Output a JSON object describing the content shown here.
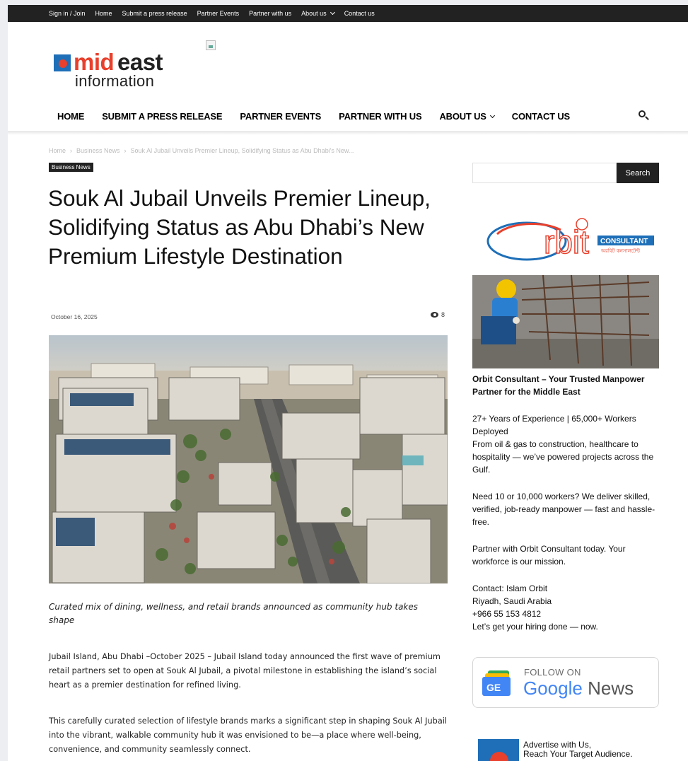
{
  "topbar": {
    "links": [
      "Sign in / Join",
      "Home",
      "Submit a press release",
      "Partner Events",
      "Partner with us",
      "About us",
      "Contact us"
    ]
  },
  "logo": {
    "part1": "mid",
    "part2": "east",
    "part3": "information"
  },
  "nav": {
    "items": [
      "HOME",
      "SUBMIT A PRESS RELEASE",
      "PARTNER EVENTS",
      "PARTNER WITH US",
      "ABOUT US",
      "CONTACT US"
    ],
    "search_icon": "search-icon"
  },
  "breadcrumb": {
    "items": [
      "Home",
      "Business News",
      "Souk Al Jubail Unveils Premier Lineup, Solidifying Status as Abu Dhabi's New..."
    ],
    "separator": "›"
  },
  "article": {
    "category": "Business News",
    "title": "Souk Al Jubail Unveils Premier Lineup, Solidifying Status as Abu Dhabi’s New Premium Lifestyle Destination",
    "date": "October 16, 2025",
    "views": "8",
    "caption": "Curated mix of dining, wellness, and retail brands announced as community hub takes shape",
    "paragraphs": [
      "Jubail Island, Abu Dhabi –October 2025 – Jubail Island today announced the first wave of premium retail partners set to open at Souk Al Jubail, a pivotal milestone in establishing the island’s social heart as a premier destination for refined living.",
      "This carefully curated selection of lifestyle brands marks a significant step in shaping Souk Al Jubail into the vibrant, walkable community hub it was envisioned to be—a place where well-being, convenience, and community seamlessly connect."
    ]
  },
  "sidebar": {
    "search_button": "Search",
    "orbit": {
      "logo_mark": "rbit",
      "logo_badge": "CONSULTANT",
      "logo_sub": "অরবিট কনসালটেন্ট"
    },
    "ad_headline": "Orbit Consultant – Your Trusted Manpower Partner for the Middle East",
    "ad_p1": "27+ Years of Experience | 65,000+ Workers Deployed\nFrom oil & gas to construction, healthcare to hospitality — we’ve powered projects across the Gulf.",
    "ad_p2": "Need 10 or 10,000 workers? We deliver skilled, verified, job-ready manpower — fast and hassle-free.",
    "ad_p3": "Partner with Orbit Consultant today. Your workforce is our mission.",
    "ad_p4": "Contact: Islam Orbit\nRiyadh, Saudi Arabia\n+966 55 153 4812\nLet’s get your hiring done — now.",
    "gnews_follow": "FOLLOW ON",
    "gnews_google": "Google",
    "gnews_news": "News",
    "gnews_badge": "GE",
    "advertise": "Advertise with Us,\nReach Your Target Audience."
  }
}
